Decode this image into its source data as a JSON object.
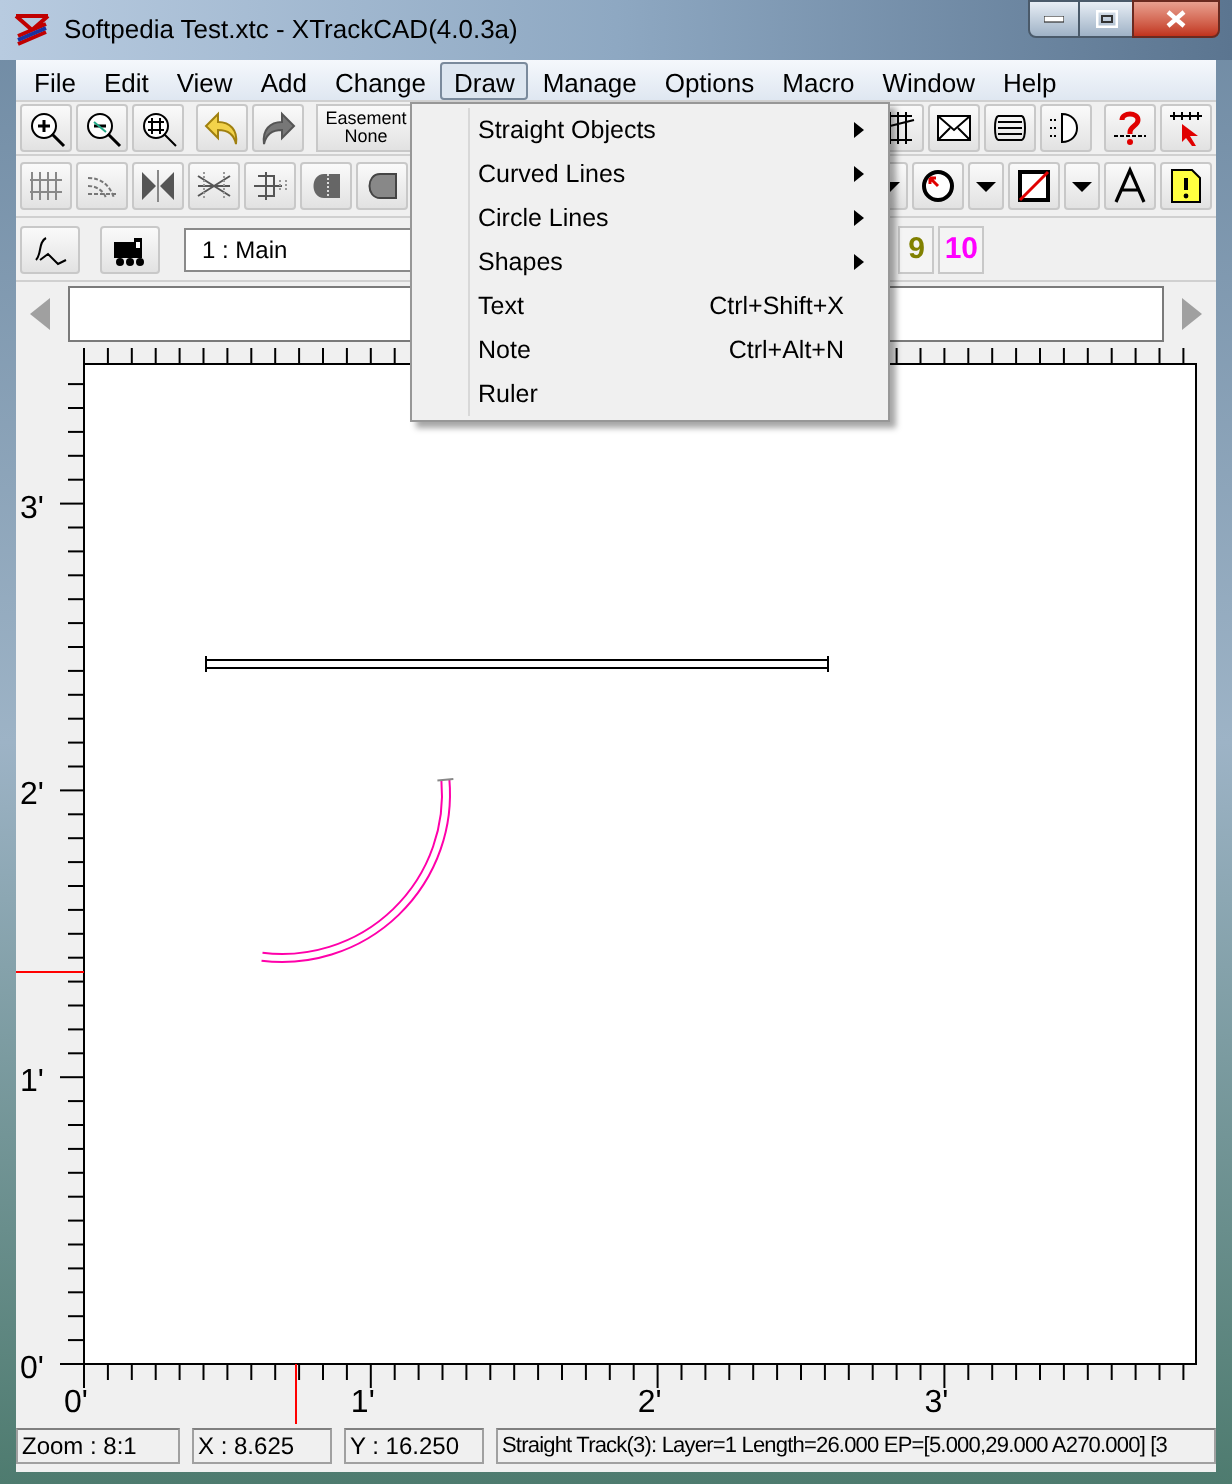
{
  "window": {
    "title": "Softpedia Test.xtc - XTrackCAD(4.0.3a)"
  },
  "menu_bar": [
    {
      "label": "File",
      "selected": false
    },
    {
      "label": "Edit",
      "selected": false
    },
    {
      "label": "View",
      "selected": false
    },
    {
      "label": "Add",
      "selected": false
    },
    {
      "label": "Change",
      "selected": false
    },
    {
      "label": "Draw",
      "selected": true
    },
    {
      "label": "Manage",
      "selected": false
    },
    {
      "label": "Options",
      "selected": false
    },
    {
      "label": "Macro",
      "selected": false
    },
    {
      "label": "Window",
      "selected": false
    },
    {
      "label": "Help",
      "selected": false
    }
  ],
  "toolbar": {
    "easement_button": {
      "label": "Easement",
      "value": "None"
    },
    "layer_select": {
      "value": "1 : Main"
    },
    "layer_buttons": [
      {
        "label": "9",
        "color": "#808000"
      },
      {
        "label": "10",
        "color": "#ff00ff"
      }
    ]
  },
  "draw_menu": [
    {
      "label": "Straight Objects",
      "submenu": true
    },
    {
      "label": "Curved Lines",
      "submenu": true
    },
    {
      "label": "Circle Lines",
      "submenu": true
    },
    {
      "label": "Shapes",
      "submenu": true
    },
    {
      "label": "Text",
      "shortcut": "Ctrl+Shift+X",
      "submenu": false
    },
    {
      "label": "Note",
      "shortcut": "Ctrl+Alt+N",
      "submenu": false
    },
    {
      "label": "Ruler",
      "submenu": false
    }
  ],
  "canvas": {
    "x_ruler_labels": [
      "0'",
      "1'",
      "2'",
      "3'"
    ],
    "y_ruler_labels": [
      "3'",
      "2'",
      "1'",
      "0'"
    ]
  },
  "status_bar": [
    "Zoom : 8:1",
    "X : 8.625",
    "Y : 16.250",
    "Straight Track(3): Layer=1 Length=26.000 EP=[5.000,29.000 A270.000] [3"
  ]
}
